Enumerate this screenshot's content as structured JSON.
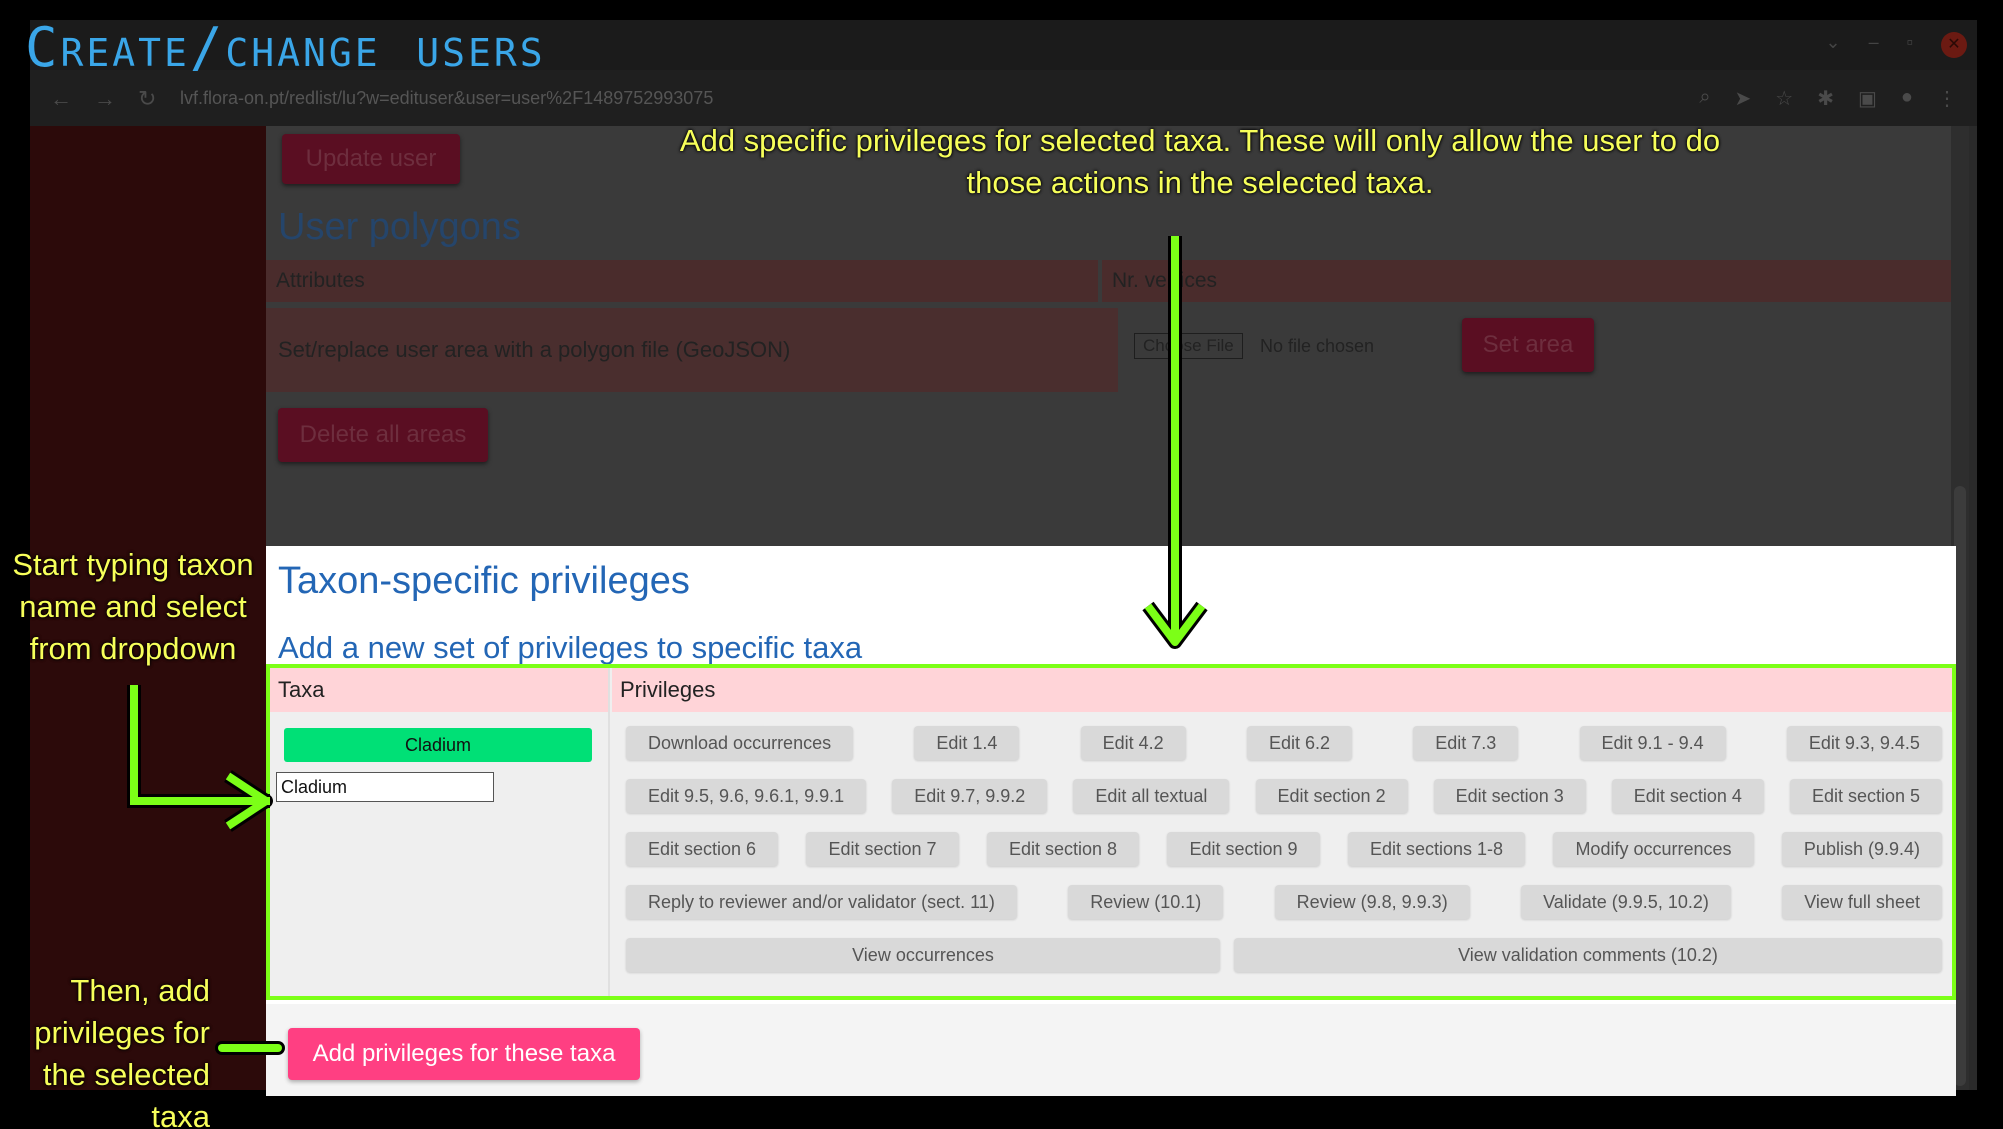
{
  "overlay": {
    "title": "Create/change users",
    "note_top": "Add specific privileges for selected taxa. These will only allow the user to do those actions in the selected taxa.",
    "note_left": "Start typing taxon name and select from dropdown",
    "note_bottom": "Then, add privileges for the selected taxa",
    "accent_color": "#7cff17",
    "note_color": "#f7ff5a"
  },
  "browser": {
    "url": "lvf.flora-on.pt/redlist/lu?w=edituser&user=user%2F1489752993075"
  },
  "page": {
    "update_button": "Update user",
    "polygons_heading": "User polygons",
    "polygons_columns": [
      "Attributes",
      "Nr. vertices"
    ],
    "replace_label": "Set/replace user area with a polygon file (GeoJSON)",
    "choose_file": "Choose File",
    "no_file": "No file chosen",
    "set_area_button": "Set area",
    "delete_areas_button": "Delete all areas",
    "taxon_heading": "Taxon-specific privileges",
    "add_set_heading": "Add a new set of privileges to specific taxa",
    "taxa_header": "Taxa",
    "privileges_header": "Privileges",
    "selected_taxon": "Cladium",
    "taxon_input_value": "Cladium",
    "add_privileges_button": "Add privileges for these taxa",
    "privileges": [
      [
        "Download occurrences",
        "Edit 1.4",
        "Edit 4.2",
        "Edit 6.2",
        "Edit 7.3",
        "Edit 9.1 - 9.4",
        "Edit 9.3, 9.4.5"
      ],
      [
        "Edit 9.5, 9.6, 9.6.1, 9.9.1",
        "Edit 9.7, 9.9.2",
        "Edit all textual",
        "Edit section 2",
        "Edit section 3",
        "Edit section 4",
        "Edit section 5"
      ],
      [
        "Edit section 6",
        "Edit section 7",
        "Edit section 8",
        "Edit section 9",
        "Edit sections 1-8",
        "Modify occurrences",
        "Publish (9.9.4)"
      ],
      [
        "Reply to reviewer and/or validator (sect. 11)",
        "Review (10.1)",
        "Review (9.8, 9.9.3)",
        "Validate (9.9.5, 10.2)",
        "View full sheet"
      ],
      [
        "View occurrences",
        "View validation comments (10.2)"
      ]
    ]
  }
}
